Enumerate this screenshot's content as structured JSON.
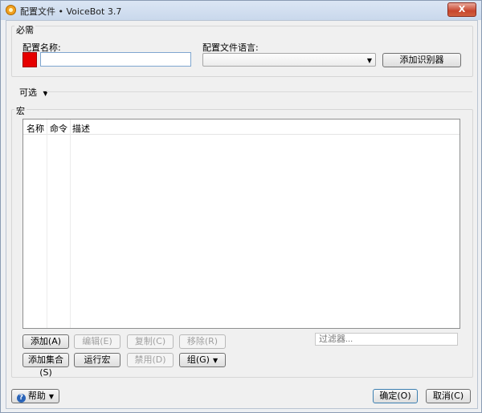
{
  "window": {
    "title": "配置文件 • VoiceBot 3.7",
    "close_label": "X"
  },
  "required": {
    "group_label": "必需",
    "name_label": "配置名称:",
    "name_value": "",
    "name_color": "#e60000",
    "language_label": "配置文件语言:",
    "language_value": "",
    "add_recognizer": "添加识别器"
  },
  "optional": {
    "label": "可选"
  },
  "macros": {
    "group_label": "宏",
    "columns": [
      "名称",
      "命令",
      "描述"
    ],
    "rows": [],
    "buttons": {
      "add": "添加(A)",
      "edit": "编辑(E)",
      "copy": "复制(C)",
      "remove": "移除(R)",
      "add_collection": "添加集合(S)",
      "run_macro": "运行宏",
      "disable": "禁用(D)",
      "group": "组(G)"
    },
    "filter_placeholder": "过滤器..."
  },
  "footer": {
    "help": "帮助",
    "ok": "确定(O)",
    "cancel": "取消(C)"
  }
}
